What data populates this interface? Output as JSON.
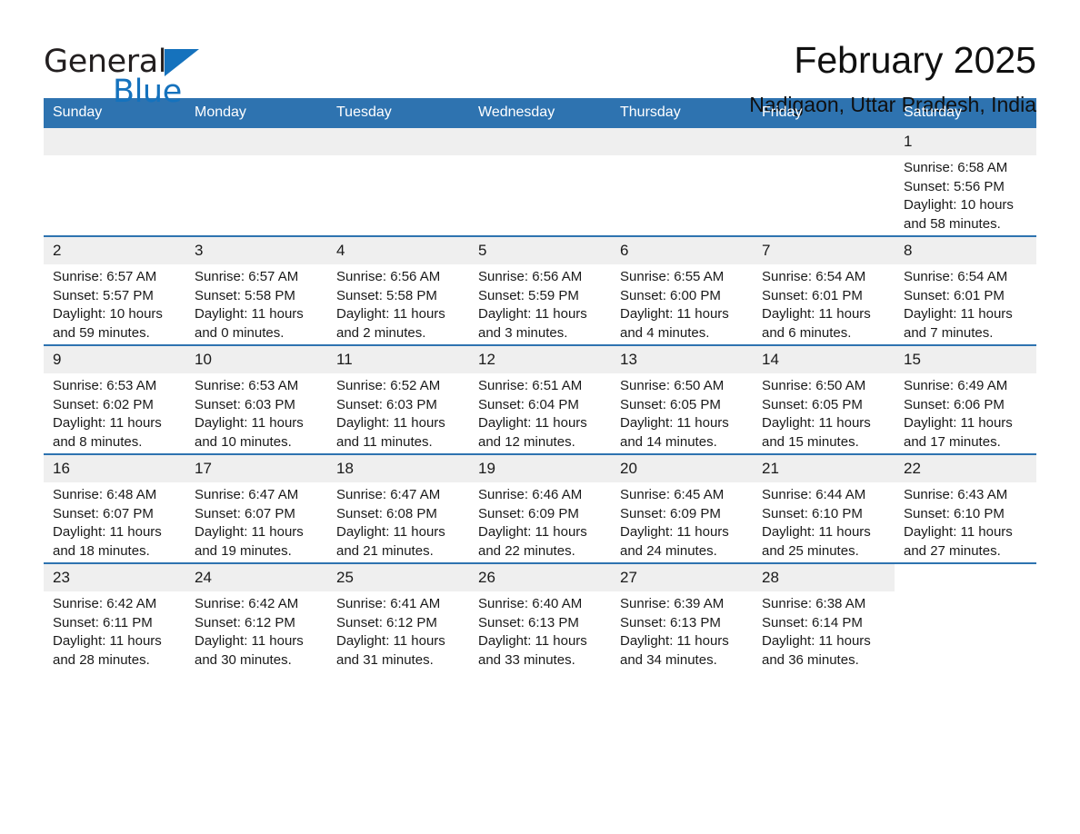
{
  "brand": {
    "name_top": "General",
    "name_bottom": "Blue",
    "triangle_color": "#1572bd"
  },
  "header": {
    "title": "February 2025",
    "subtitle": "Nadigaon, Uttar Pradesh, India"
  },
  "theme": {
    "header_blue": "#2e73b0",
    "daynum_bg": "#efefef",
    "text": "#1a1a1a"
  },
  "weekdays": [
    "Sunday",
    "Monday",
    "Tuesday",
    "Wednesday",
    "Thursday",
    "Friday",
    "Saturday"
  ],
  "weeks": [
    [
      {
        "day": "",
        "blank": true
      },
      {
        "day": "",
        "blank": true
      },
      {
        "day": "",
        "blank": true
      },
      {
        "day": "",
        "blank": true
      },
      {
        "day": "",
        "blank": true
      },
      {
        "day": "",
        "blank": true
      },
      {
        "day": "1",
        "sunrise": "Sunrise: 6:58 AM",
        "sunset": "Sunset: 5:56 PM",
        "daylight1": "Daylight: 10 hours",
        "daylight2": "and 58 minutes."
      }
    ],
    [
      {
        "day": "2",
        "sunrise": "Sunrise: 6:57 AM",
        "sunset": "Sunset: 5:57 PM",
        "daylight1": "Daylight: 10 hours",
        "daylight2": "and 59 minutes."
      },
      {
        "day": "3",
        "sunrise": "Sunrise: 6:57 AM",
        "sunset": "Sunset: 5:58 PM",
        "daylight1": "Daylight: 11 hours",
        "daylight2": "and 0 minutes."
      },
      {
        "day": "4",
        "sunrise": "Sunrise: 6:56 AM",
        "sunset": "Sunset: 5:58 PM",
        "daylight1": "Daylight: 11 hours",
        "daylight2": "and 2 minutes."
      },
      {
        "day": "5",
        "sunrise": "Sunrise: 6:56 AM",
        "sunset": "Sunset: 5:59 PM",
        "daylight1": "Daylight: 11 hours",
        "daylight2": "and 3 minutes."
      },
      {
        "day": "6",
        "sunrise": "Sunrise: 6:55 AM",
        "sunset": "Sunset: 6:00 PM",
        "daylight1": "Daylight: 11 hours",
        "daylight2": "and 4 minutes."
      },
      {
        "day": "7",
        "sunrise": "Sunrise: 6:54 AM",
        "sunset": "Sunset: 6:01 PM",
        "daylight1": "Daylight: 11 hours",
        "daylight2": "and 6 minutes."
      },
      {
        "day": "8",
        "sunrise": "Sunrise: 6:54 AM",
        "sunset": "Sunset: 6:01 PM",
        "daylight1": "Daylight: 11 hours",
        "daylight2": "and 7 minutes."
      }
    ],
    [
      {
        "day": "9",
        "sunrise": "Sunrise: 6:53 AM",
        "sunset": "Sunset: 6:02 PM",
        "daylight1": "Daylight: 11 hours",
        "daylight2": "and 8 minutes."
      },
      {
        "day": "10",
        "sunrise": "Sunrise: 6:53 AM",
        "sunset": "Sunset: 6:03 PM",
        "daylight1": "Daylight: 11 hours",
        "daylight2": "and 10 minutes."
      },
      {
        "day": "11",
        "sunrise": "Sunrise: 6:52 AM",
        "sunset": "Sunset: 6:03 PM",
        "daylight1": "Daylight: 11 hours",
        "daylight2": "and 11 minutes."
      },
      {
        "day": "12",
        "sunrise": "Sunrise: 6:51 AM",
        "sunset": "Sunset: 6:04 PM",
        "daylight1": "Daylight: 11 hours",
        "daylight2": "and 12 minutes."
      },
      {
        "day": "13",
        "sunrise": "Sunrise: 6:50 AM",
        "sunset": "Sunset: 6:05 PM",
        "daylight1": "Daylight: 11 hours",
        "daylight2": "and 14 minutes."
      },
      {
        "day": "14",
        "sunrise": "Sunrise: 6:50 AM",
        "sunset": "Sunset: 6:05 PM",
        "daylight1": "Daylight: 11 hours",
        "daylight2": "and 15 minutes."
      },
      {
        "day": "15",
        "sunrise": "Sunrise: 6:49 AM",
        "sunset": "Sunset: 6:06 PM",
        "daylight1": "Daylight: 11 hours",
        "daylight2": "and 17 minutes."
      }
    ],
    [
      {
        "day": "16",
        "sunrise": "Sunrise: 6:48 AM",
        "sunset": "Sunset: 6:07 PM",
        "daylight1": "Daylight: 11 hours",
        "daylight2": "and 18 minutes."
      },
      {
        "day": "17",
        "sunrise": "Sunrise: 6:47 AM",
        "sunset": "Sunset: 6:07 PM",
        "daylight1": "Daylight: 11 hours",
        "daylight2": "and 19 minutes."
      },
      {
        "day": "18",
        "sunrise": "Sunrise: 6:47 AM",
        "sunset": "Sunset: 6:08 PM",
        "daylight1": "Daylight: 11 hours",
        "daylight2": "and 21 minutes."
      },
      {
        "day": "19",
        "sunrise": "Sunrise: 6:46 AM",
        "sunset": "Sunset: 6:09 PM",
        "daylight1": "Daylight: 11 hours",
        "daylight2": "and 22 minutes."
      },
      {
        "day": "20",
        "sunrise": "Sunrise: 6:45 AM",
        "sunset": "Sunset: 6:09 PM",
        "daylight1": "Daylight: 11 hours",
        "daylight2": "and 24 minutes."
      },
      {
        "day": "21",
        "sunrise": "Sunrise: 6:44 AM",
        "sunset": "Sunset: 6:10 PM",
        "daylight1": "Daylight: 11 hours",
        "daylight2": "and 25 minutes."
      },
      {
        "day": "22",
        "sunrise": "Sunrise: 6:43 AM",
        "sunset": "Sunset: 6:10 PM",
        "daylight1": "Daylight: 11 hours",
        "daylight2": "and 27 minutes."
      }
    ],
    [
      {
        "day": "23",
        "sunrise": "Sunrise: 6:42 AM",
        "sunset": "Sunset: 6:11 PM",
        "daylight1": "Daylight: 11 hours",
        "daylight2": "and 28 minutes."
      },
      {
        "day": "24",
        "sunrise": "Sunrise: 6:42 AM",
        "sunset": "Sunset: 6:12 PM",
        "daylight1": "Daylight: 11 hours",
        "daylight2": "and 30 minutes."
      },
      {
        "day": "25",
        "sunrise": "Sunrise: 6:41 AM",
        "sunset": "Sunset: 6:12 PM",
        "daylight1": "Daylight: 11 hours",
        "daylight2": "and 31 minutes."
      },
      {
        "day": "26",
        "sunrise": "Sunrise: 6:40 AM",
        "sunset": "Sunset: 6:13 PM",
        "daylight1": "Daylight: 11 hours",
        "daylight2": "and 33 minutes."
      },
      {
        "day": "27",
        "sunrise": "Sunrise: 6:39 AM",
        "sunset": "Sunset: 6:13 PM",
        "daylight1": "Daylight: 11 hours",
        "daylight2": "and 34 minutes."
      },
      {
        "day": "28",
        "sunrise": "Sunrise: 6:38 AM",
        "sunset": "Sunset: 6:14 PM",
        "daylight1": "Daylight: 11 hours",
        "daylight2": "and 36 minutes."
      },
      {
        "day": "",
        "blank": true
      }
    ]
  ]
}
